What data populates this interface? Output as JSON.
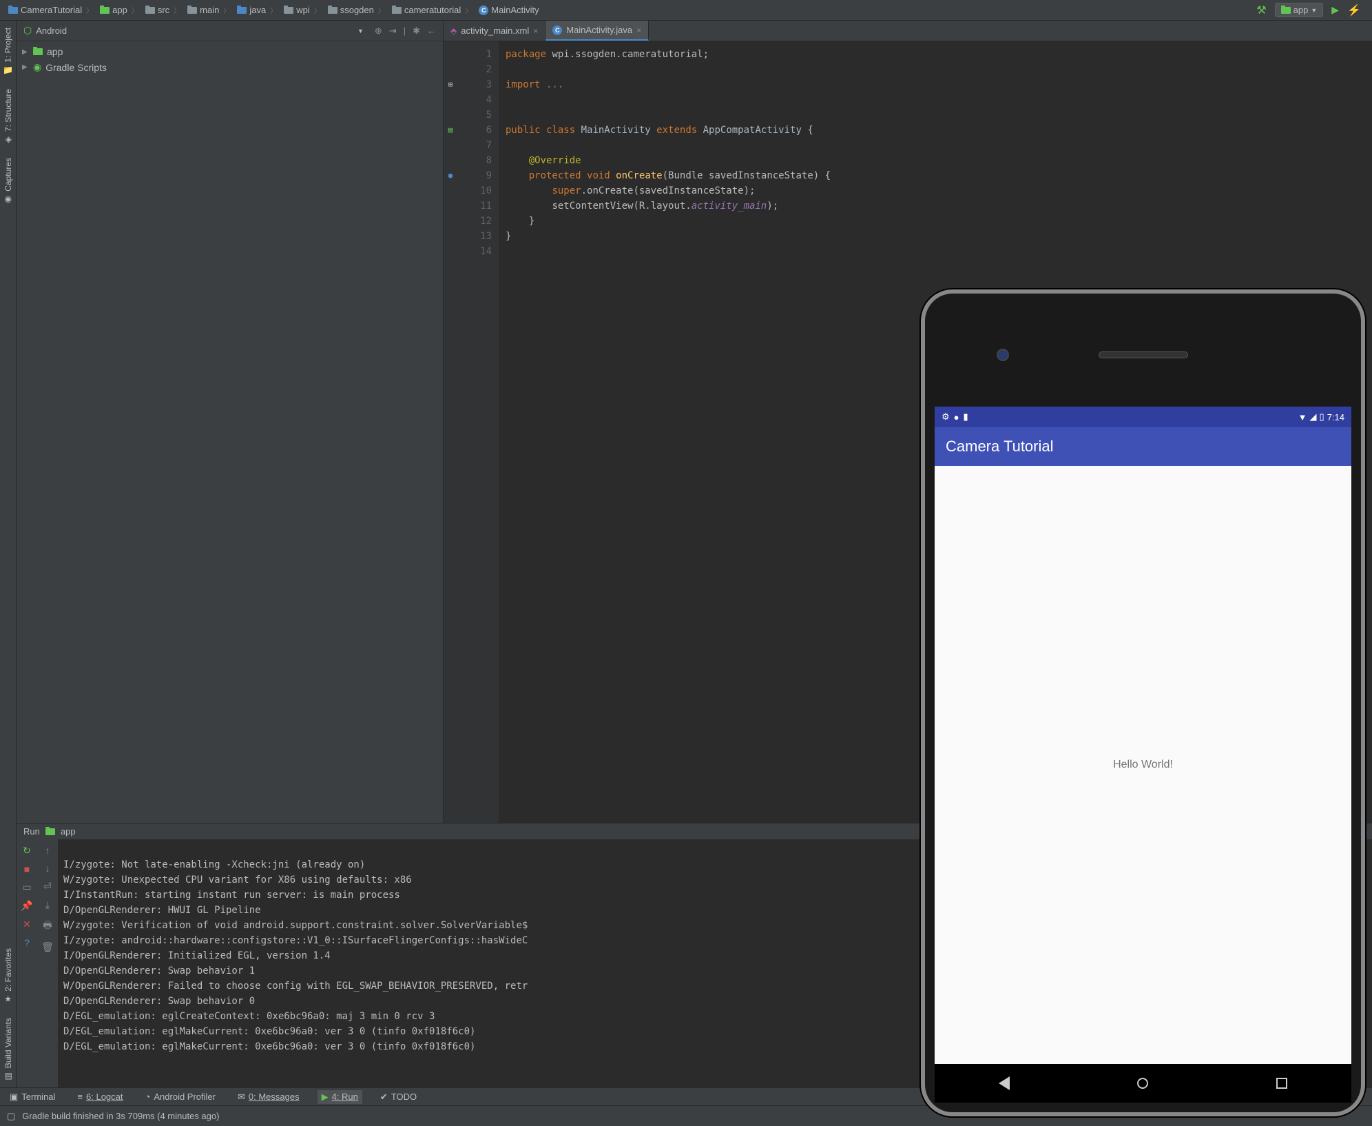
{
  "breadcrumbs": [
    {
      "label": "CameraTutorial",
      "icon": "project"
    },
    {
      "label": "app",
      "icon": "module"
    },
    {
      "label": "src",
      "icon": "folder"
    },
    {
      "label": "main",
      "icon": "folder"
    },
    {
      "label": "java",
      "icon": "folder-blue"
    },
    {
      "label": "wpi",
      "icon": "folder"
    },
    {
      "label": "ssogden",
      "icon": "folder"
    },
    {
      "label": "cameratutorial",
      "icon": "folder"
    },
    {
      "label": "MainActivity",
      "icon": "class"
    }
  ],
  "run_config": {
    "label": "app"
  },
  "left_rail": [
    {
      "label": "1: Project",
      "icon": "📁"
    },
    {
      "label": "7: Structure",
      "icon": "◈"
    },
    {
      "label": "Captures",
      "icon": "◉"
    },
    {
      "label": "2: Favorites",
      "icon": "★"
    },
    {
      "label": "Build Variants",
      "icon": "▤"
    }
  ],
  "project_panel": {
    "title": "Android",
    "items": [
      {
        "label": "app",
        "icon": "module"
      },
      {
        "label": "Gradle Scripts",
        "icon": "gradle"
      }
    ]
  },
  "editor_tabs": [
    {
      "label": "activity_main.xml",
      "active": false,
      "icon": "xml"
    },
    {
      "label": "MainActivity.java",
      "active": true,
      "icon": "class"
    }
  ],
  "code": {
    "lines": [
      "1",
      "2",
      "3",
      "4",
      "5",
      "6",
      "7",
      "8",
      "9",
      "10",
      "11",
      "12",
      "13",
      "14"
    ],
    "package_kw": "package",
    "package_val": " wpi.ssogden.cameratutorial;",
    "import_kw": "import",
    "import_dots": " ...",
    "public_kw": "public ",
    "class_kw": "class ",
    "class_name": "MainActivity ",
    "extends_kw": "extends ",
    "parent": "AppCompatActivity {",
    "override": "@Override",
    "protected_kw": "protected ",
    "void_kw": "void ",
    "method_name": "onCreate",
    "sig": "(Bundle savedInstanceState) {",
    "super_kw": "super",
    "super_call": ".onCreate(savedInstanceState);",
    "scv": "setContentView(R.layout.",
    "layout_field": "activity_main",
    "scv_end": ");",
    "brace_close_inner": "    }",
    "brace_close_outer": "}"
  },
  "run": {
    "title_prefix": "Run",
    "title_target": "app",
    "lines": [
      "I/zygote: Not late-enabling -Xcheck:jni (already on)",
      "W/zygote: Unexpected CPU variant for X86 using defaults: x86",
      "I/InstantRun: starting instant run server: is main process",
      "D/OpenGLRenderer: HWUI GL Pipeline",
      "W/zygote: Verification of void android.support.constraint.solver.SolverVariable$",
      "I/zygote: android::hardware::configstore::V1_0::ISurfaceFlingerConfigs::hasWideC",
      "I/OpenGLRenderer: Initialized EGL, version 1.4",
      "D/OpenGLRenderer: Swap behavior 1",
      "W/OpenGLRenderer: Failed to choose config with EGL_SWAP_BEHAVIOR_PRESERVED, retr",
      "D/OpenGLRenderer: Swap behavior 0",
      "D/EGL_emulation: eglCreateContext: 0xe6bc96a0: maj 3 min 0 rcv 3",
      "D/EGL_emulation: eglMakeCurrent: 0xe6bc96a0: ver 3 0 (tinfo 0xf018f6c0)",
      "D/EGL_emulation: eglMakeCurrent: 0xe6bc96a0: ver 3 0 (tinfo 0xf018f6c0)"
    ]
  },
  "bottom_tabs": [
    {
      "label": "Terminal",
      "icon": "▣"
    },
    {
      "label": "6: Logcat",
      "icon": "≡"
    },
    {
      "label": "Android Profiler",
      "icon": "◔"
    },
    {
      "label": "0: Messages",
      "icon": "✉"
    },
    {
      "label": "4: Run",
      "icon": "▶",
      "active": true
    },
    {
      "label": "TODO",
      "icon": "✔"
    }
  ],
  "status_bar": {
    "message": "Gradle build finished in 3s 709ms (4 minutes ago)"
  },
  "emulator": {
    "status_time": "7:14",
    "app_title": "Camera Tutorial",
    "content_text": "Hello World!"
  }
}
